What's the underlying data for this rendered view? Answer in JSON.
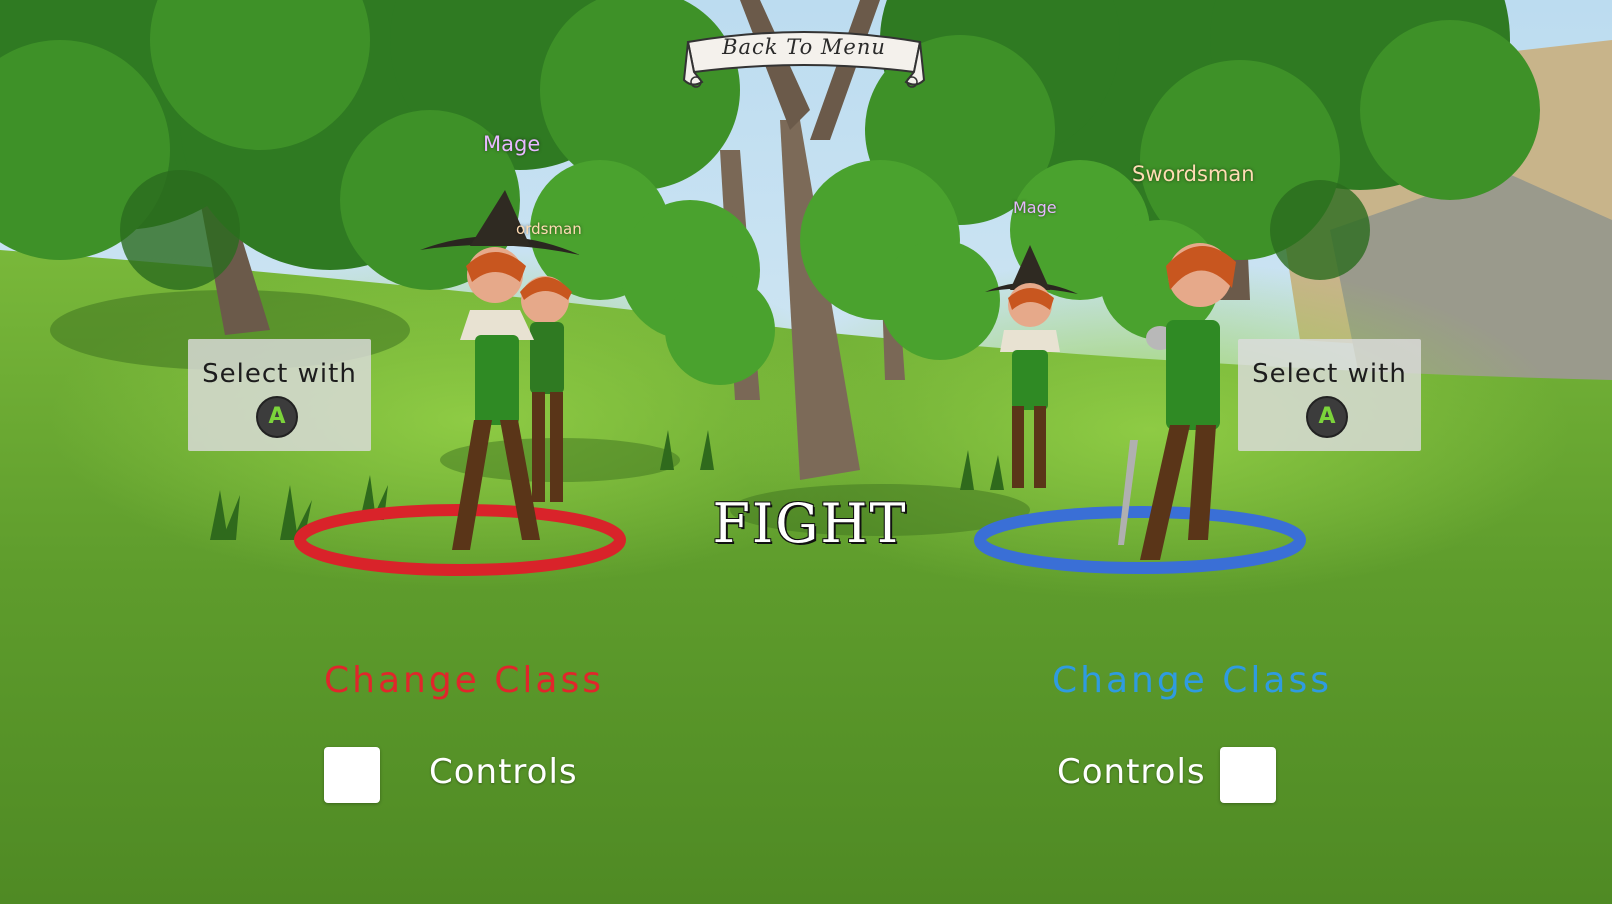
{
  "menu": {
    "back_label": "Back To Menu"
  },
  "characters": {
    "mage_left_tag": "Mage",
    "sword_left_tag": "Swordsman",
    "sword_left_tag_visible": "ordsman",
    "mage_right_tag": "Mage",
    "sword_right_tag": "Swordsman"
  },
  "player1": {
    "select_label": "Select with",
    "button_glyph": "A",
    "change_class_label": "Change Class",
    "controls_label": "Controls",
    "accent_color": "#e0262b",
    "ring_color": "#e0262b"
  },
  "player2": {
    "select_label": "Select with",
    "button_glyph": "A",
    "change_class_label": "Change Class",
    "controls_label": "Controls",
    "accent_color": "#2f9be0",
    "ring_color": "#3a6fd6"
  },
  "fight": {
    "label": "FIGHT"
  },
  "icons": {
    "a_button": "gamepad-a-button-icon",
    "banner": "scroll-banner-icon"
  }
}
